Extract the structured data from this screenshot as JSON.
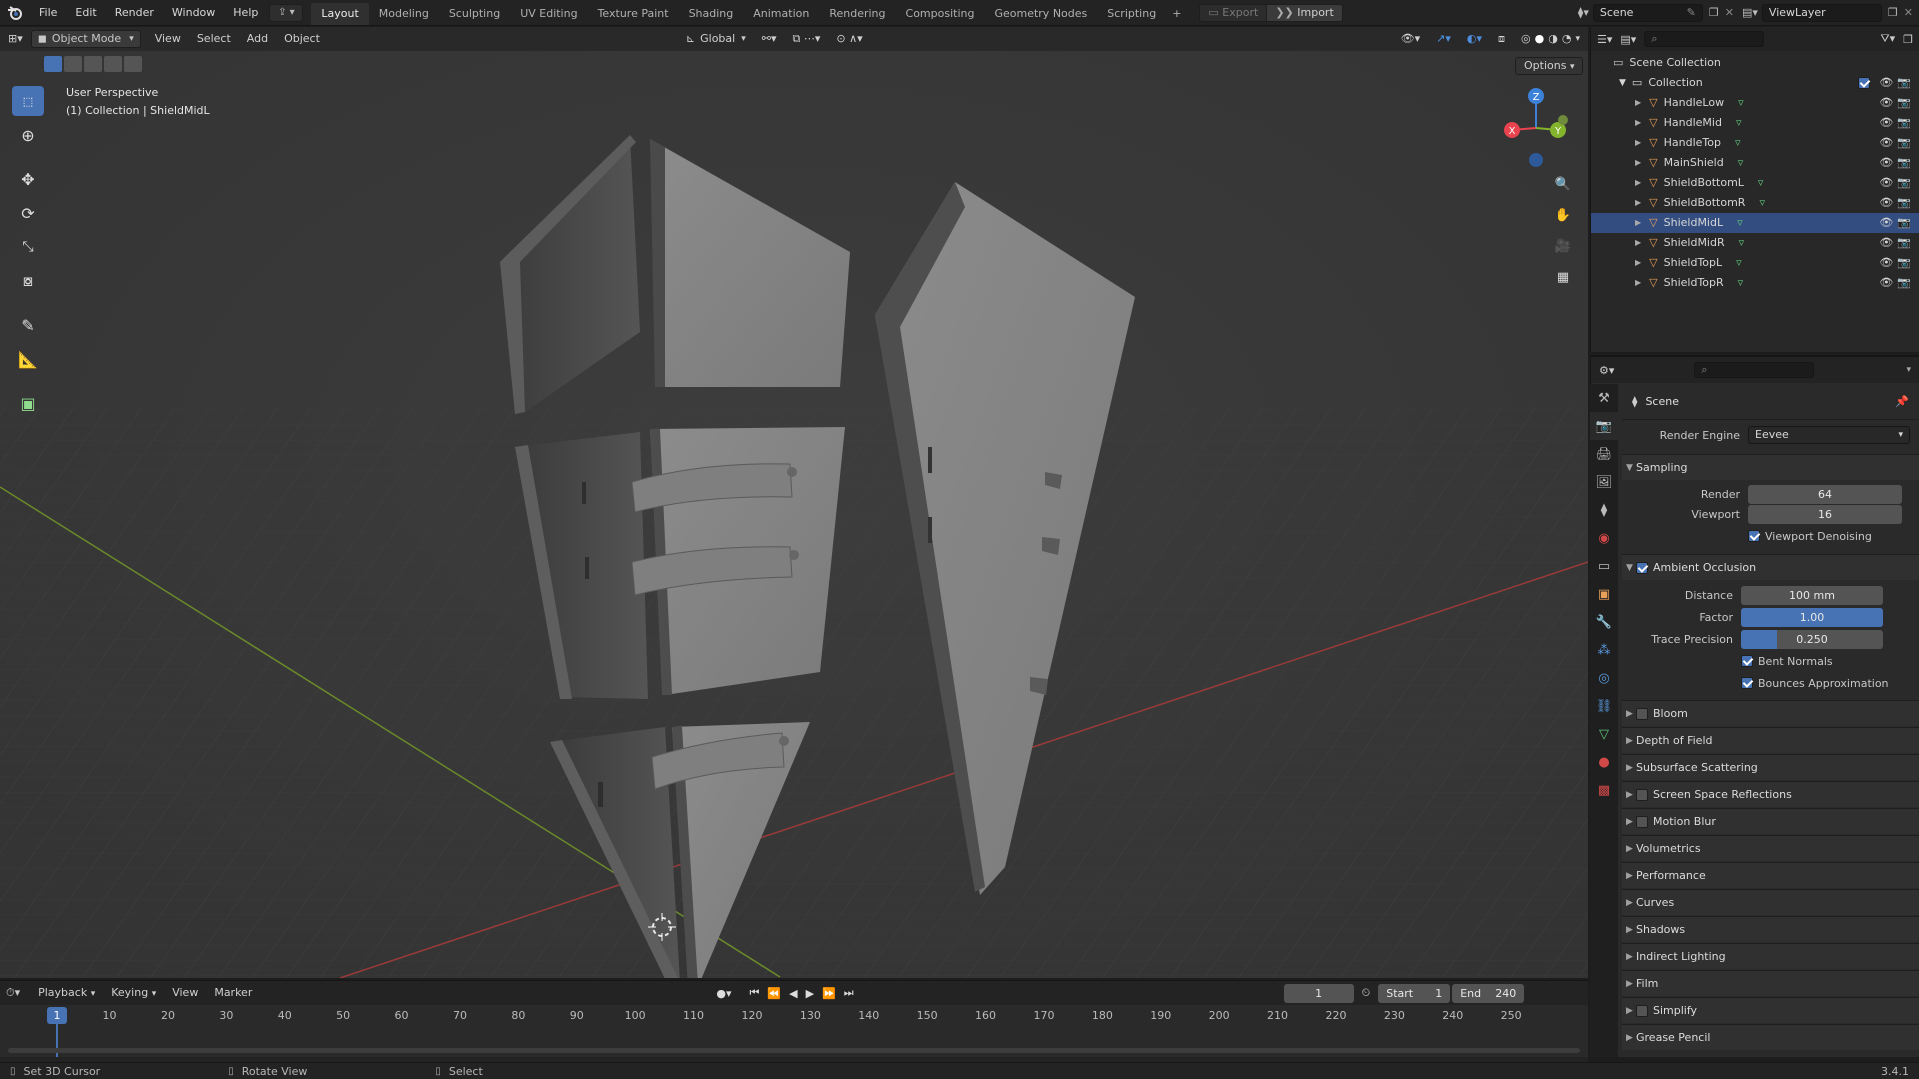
{
  "topbar": {
    "menus": [
      "File",
      "Edit",
      "Render",
      "Window",
      "Help"
    ],
    "workspaces": [
      "Layout",
      "Modeling",
      "Sculpting",
      "UV Editing",
      "Texture Paint",
      "Shading",
      "Animation",
      "Rendering",
      "Compositing",
      "Geometry Nodes",
      "Scripting"
    ],
    "active_workspace": "Layout",
    "add_workspace": "+",
    "export_label": "Export",
    "import_label": "Import",
    "scene_name": "Scene",
    "view_layer": "ViewLayer"
  },
  "viewport_header": {
    "mode": "Object Mode",
    "menus": [
      "View",
      "Select",
      "Add",
      "Object"
    ],
    "transform_orientation": "Global",
    "options_label": "Options"
  },
  "viewport": {
    "perspective_label": "User Perspective",
    "collection_label": "(1) Collection | ShieldMidL",
    "gizmo_axes": {
      "x": "X",
      "y": "Y",
      "z": "Z"
    }
  },
  "outliner": {
    "root": "Scene Collection",
    "collection": "Collection",
    "objects": [
      "HandleLow",
      "HandleMid",
      "HandleTop",
      "MainShield",
      "ShieldBottomL",
      "ShieldBottomR",
      "ShieldMidL",
      "ShieldMidR",
      "ShieldTopL",
      "ShieldTopR"
    ],
    "active_object": "ShieldMidL"
  },
  "properties": {
    "context": "Scene",
    "render_engine_label": "Render Engine",
    "render_engine": "Eevee",
    "sampling": {
      "title": "Sampling",
      "render_label": "Render",
      "render_value": "64",
      "viewport_label": "Viewport",
      "viewport_value": "16",
      "denoise_label": "Viewport Denoising"
    },
    "ambient_occlusion": {
      "title": "Ambient Occlusion",
      "distance_label": "Distance",
      "distance_value": "100 mm",
      "factor_label": "Factor",
      "factor_value": "1.00",
      "factor_fill": 1.0,
      "trace_label": "Trace Precision",
      "trace_value": "0.250",
      "trace_fill": 0.25,
      "bent_normals_label": "Bent Normals",
      "bounces_label": "Bounces Approximation"
    },
    "panels": [
      {
        "label": "Bloom",
        "checkbox": true
      },
      {
        "label": "Depth of Field",
        "checkbox": false
      },
      {
        "label": "Subsurface Scattering",
        "checkbox": false
      },
      {
        "label": "Screen Space Reflections",
        "checkbox": true
      },
      {
        "label": "Motion Blur",
        "checkbox": true
      },
      {
        "label": "Volumetrics",
        "checkbox": false
      },
      {
        "label": "Performance",
        "checkbox": false
      },
      {
        "label": "Curves",
        "checkbox": false
      },
      {
        "label": "Shadows",
        "checkbox": false
      },
      {
        "label": "Indirect Lighting",
        "checkbox": false
      },
      {
        "label": "Film",
        "checkbox": false
      },
      {
        "label": "Simplify",
        "checkbox": true
      },
      {
        "label": "Grease Pencil",
        "checkbox": false
      }
    ]
  },
  "timeline": {
    "menus": [
      "Playback",
      "Keying",
      "View",
      "Marker"
    ],
    "current_frame": "1",
    "start_label": "Start",
    "start_value": "1",
    "end_label": "End",
    "end_value": "240",
    "ruler": [
      "1",
      "10",
      "20",
      "30",
      "40",
      "50",
      "60",
      "70",
      "80",
      "90",
      "100",
      "110",
      "120",
      "130",
      "140",
      "150",
      "160",
      "170",
      "180",
      "190",
      "200",
      "210",
      "220",
      "230",
      "240",
      "250"
    ]
  },
  "statusbar": {
    "left": "Set 3D Cursor",
    "middle": "Rotate View",
    "right": "Select",
    "version": "3.4.1"
  },
  "colors": {
    "accent": "#4772b3",
    "selection": "#334d80",
    "object_orange": "#e8a05a",
    "mesh_green": "#5fc47a",
    "axis_x": "#e8434f",
    "axis_y": "#84b32c",
    "axis_z": "#3d82d9"
  },
  "icons": [
    "blender-logo",
    "select-box-icon",
    "cursor-icon",
    "move-icon",
    "rotate-icon",
    "scale-icon",
    "transform-icon",
    "annotate-icon",
    "measure-icon",
    "add-cube-icon",
    "eye-icon",
    "camera-icon",
    "object-icon",
    "mesh-icon",
    "zoom-icon",
    "hand-icon",
    "camera-view-icon",
    "grid-icon"
  ]
}
